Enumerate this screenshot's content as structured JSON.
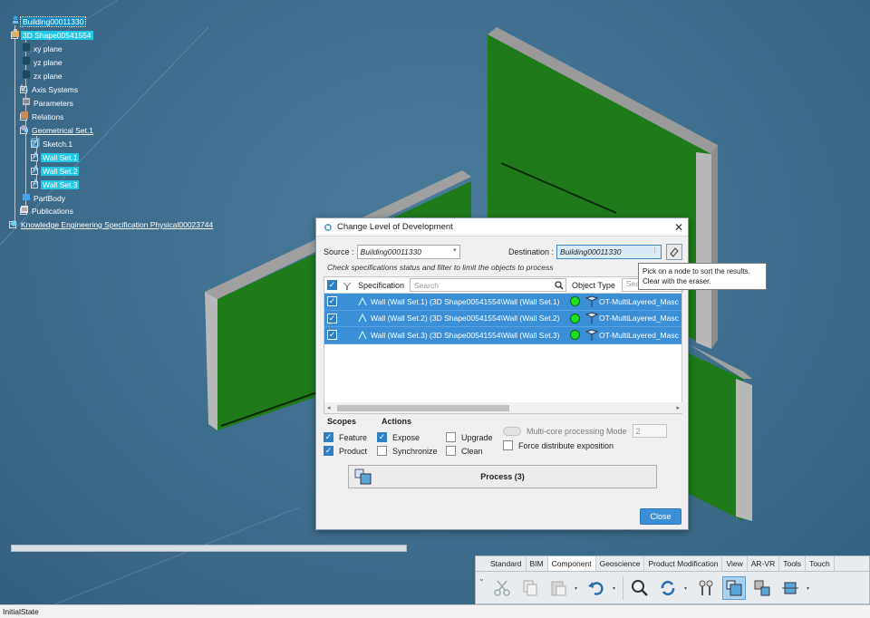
{
  "tree": {
    "root": "Building00011330",
    "shape": "3D Shape00541554",
    "items": [
      "xy plane",
      "yz plane",
      "zx plane",
      "Axis Systems",
      "Parameters",
      "Relations",
      "Geometrical Set.1",
      "Sketch.1",
      "Wall Set.1",
      "Wall Set.2",
      "Wall Set.3",
      "PartBody",
      "Publications"
    ],
    "knowledge": "Knowledge Engineering Specification Physical00023744"
  },
  "dialog": {
    "title": "Change Level of Development",
    "source_label": "Source :",
    "source_value": "Building00011330",
    "dest_label": "Destination :",
    "dest_value": "Building00011330",
    "hint": "Check specifications status and filter to limit the objects to process",
    "col_spec": "Specification",
    "search_placeholder": "Search",
    "col_type": "Object Type",
    "type_search": "Search",
    "rows": [
      {
        "spec": "Wall (Wall Set.1) (3D Shape00541554\\Wall (Wall Set.1)",
        "type": "OT-MultiLayered_Masc"
      },
      {
        "spec": "Wall (Wall Set.2) (3D Shape00541554\\Wall (Wall Set.2)",
        "type": "OT-MultiLayered_Masc"
      },
      {
        "spec": "Wall (Wall Set.3) (3D Shape00541554\\Wall (Wall Set.3)",
        "type": "OT-MultiLayered_Masc"
      }
    ],
    "scopes_label": "Scopes",
    "actions_label": "Actions",
    "feature": "Feature",
    "product": "Product",
    "expose": "Expose",
    "synchronize": "Synchronize",
    "upgrade": "Upgrade",
    "clean": "Clean",
    "multicore": "Multi-core processing Mode",
    "multicore_value": "2",
    "force": "Force distribute exposition",
    "process": "Process (3)",
    "close": "Close"
  },
  "tooltip": {
    "line1": "Pick on a node to sort the results.",
    "line2": "Clear with the eraser."
  },
  "toolbar": {
    "tabs": [
      "Standard",
      "BIM",
      "Component",
      "Geoscience",
      "Product Modification",
      "View",
      "AR-VR",
      "Tools",
      "Touch"
    ],
    "active_tab": "Component"
  },
  "status": "InitialState",
  "colors": {
    "selection": "#3b8fd6",
    "wall_green": "#1f7a1a",
    "viewport": "#3f6f8e"
  }
}
